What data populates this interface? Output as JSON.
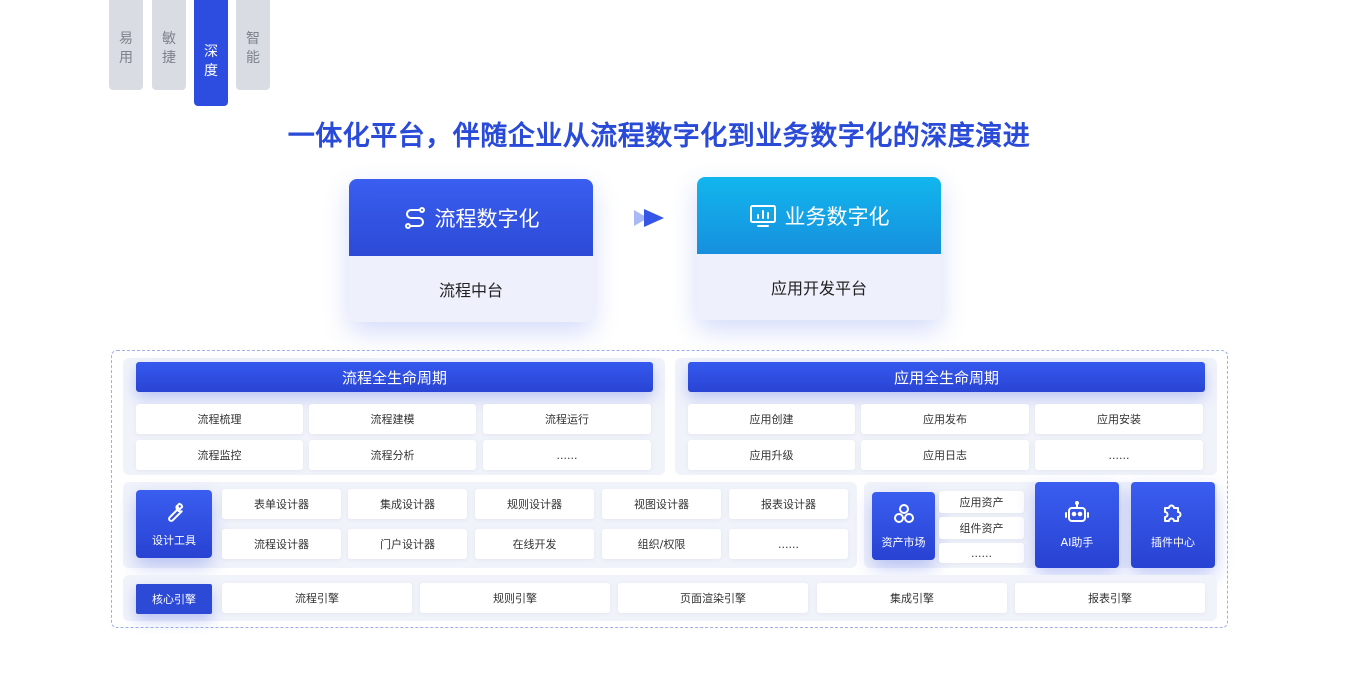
{
  "tabs": [
    "易用",
    "敏捷",
    "深度",
    "智能"
  ],
  "active_tab": "深度",
  "headline": "一体化平台，伴随企业从流程数字化到业务数字化的深度演进",
  "cards": [
    {
      "title": "流程数字化",
      "subtitle": "流程中台",
      "icon": "flow-icon"
    },
    {
      "title": "业务数字化",
      "subtitle": "应用开发平台",
      "icon": "monitor-icon"
    }
  ],
  "lifecycle": {
    "process": {
      "title": "流程全生命周期",
      "items": [
        "流程梳理",
        "流程建模",
        "流程运行",
        "流程监控",
        "流程分析",
        "......"
      ]
    },
    "app": {
      "title": "应用全生命周期",
      "items": [
        "应用创建",
        "应用发布",
        "应用安装",
        "应用升级",
        "应用日志",
        "......"
      ]
    }
  },
  "design_tools": {
    "label": "设计工具",
    "icon": "wrench-icon",
    "items": [
      "表单设计器",
      "集成设计器",
      "规则设计器",
      "视图设计器",
      "报表设计器",
      "流程设计器",
      "门户设计器",
      "在线开发",
      "组织/权限",
      "......"
    ]
  },
  "asset_market": {
    "label": "资产市场",
    "icon": "cubes-icon",
    "items": [
      "应用资产",
      "组件资产",
      "......"
    ]
  },
  "ai_assistant": {
    "label": "AI助手",
    "icon": "robot-icon"
  },
  "plugin_center": {
    "label": "插件中心",
    "icon": "puzzle-icon"
  },
  "core_engine": {
    "label": "核心引擎",
    "items": [
      "流程引擎",
      "规则引擎",
      "页面渲染引擎",
      "集成引擎",
      "报表引擎"
    ]
  }
}
